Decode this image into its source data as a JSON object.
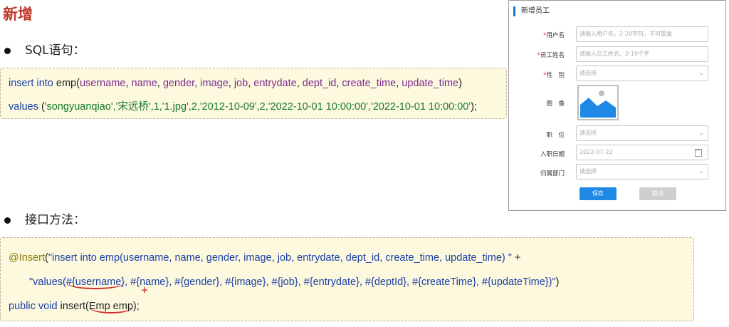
{
  "heading": "新增",
  "sections": {
    "sql_label": "SQL语句：",
    "api_label": "接口方法："
  },
  "sql": {
    "line1": {
      "kw1": "insert into",
      "table": " emp(",
      "cols": [
        "username",
        ", ",
        "name",
        ", ",
        "gender",
        ", ",
        "image",
        ", ",
        "job",
        ", ",
        "entrydate",
        ", ",
        "dept_id",
        ", ",
        "create_time",
        ", ",
        "update_time"
      ],
      "close": ")"
    },
    "line2": {
      "kw": "values",
      "open": " (",
      "vals": "'songyuanqiao','宋远桥',1,'1.jpg',2,'2012-10-09',2,'2022-10-01 10:00:00','2022-10-01 10:00:00'",
      "close": ");"
    }
  },
  "java": {
    "line1": {
      "annotation": "@Insert",
      "open": "(",
      "str": "\"insert into emp(username, name, gender, image, job, entrydate, dept_id, create_time, update_time) \"",
      "plus": " +"
    },
    "line2": {
      "str_a": "\"values(",
      "p1": "#{username}",
      "str_b": ", #{name}, #{gender}, #{image}, #{job}, #{entrydate}, #{deptId}, #{createTime}, #{updateTime})\"",
      "close": ")"
    },
    "line3": {
      "kw": "public void",
      "method": " insert(",
      "param": "Emp emp",
      "close": ");"
    },
    "plus_mark": "+"
  },
  "form": {
    "title": "新增员工",
    "fields": [
      {
        "label": "用户名",
        "required": "*",
        "placeholder": "请输入用户名，2-20字符，不可重复"
      },
      {
        "label": "员工姓名",
        "required": "*",
        "placeholder": "请输入员工姓名，2-10个字"
      },
      {
        "label": "性　别",
        "required": "*",
        "placeholder": "请选择"
      },
      {
        "label": "图　像",
        "required": ""
      },
      {
        "label": "职　位",
        "required": "",
        "placeholder": "请选择"
      },
      {
        "label": "入职日期",
        "required": "",
        "placeholder": "2022-07-22"
      },
      {
        "label": "归属部门",
        "required": "",
        "placeholder": "请选择"
      }
    ],
    "save": "保存",
    "cancel": "取消",
    "colors": {
      "accent": "#1e88e5",
      "image_blue": "#1e88e5"
    }
  }
}
